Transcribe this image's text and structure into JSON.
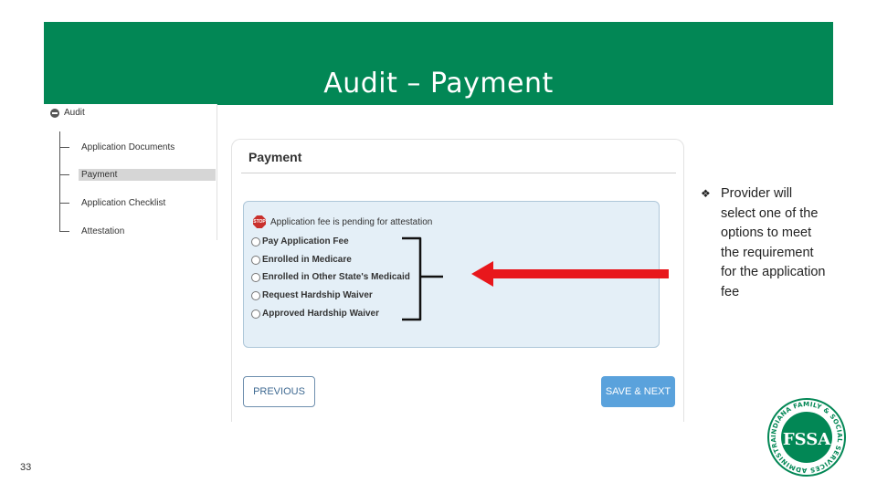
{
  "slide": {
    "title": "Audit – Payment",
    "number": "33"
  },
  "tree": {
    "root_label": "Audit",
    "items": [
      {
        "label": "Application Documents"
      },
      {
        "label": "Payment"
      },
      {
        "label": "Application Checklist"
      },
      {
        "label": "Attestation"
      }
    ]
  },
  "panel": {
    "title": "Payment",
    "pending_text": "Application fee is pending for attestation",
    "stop_icon_text": "STOP",
    "options": [
      {
        "label": "Pay Application Fee"
      },
      {
        "label": "Enrolled in Medicare"
      },
      {
        "label": "Enrolled in Other State's Medicaid"
      },
      {
        "label": "Request Hardship Waiver"
      },
      {
        "label": "Approved Hardship Waiver"
      }
    ],
    "previous_label": "PREVIOUS",
    "next_label": "SAVE & NEXT"
  },
  "note": {
    "marker": "❖",
    "text": "Provider will select one of the options to meet the requirement for the application fee"
  },
  "logo": {
    "letters": "FSSA",
    "ring_text": "INDIANA FAMILY & SOCIAL SERVICES ADMINISTRATION"
  },
  "colors": {
    "banner_green": "#028755",
    "arrow_red": "#e8171c",
    "option_box_bg": "#e4eff7",
    "next_button_blue": "#5aa2dc"
  },
  "icons": {
    "collapse": "minus-circle-icon",
    "stop": "stop-sign-icon",
    "bullet": "diamond-bullet-icon"
  }
}
